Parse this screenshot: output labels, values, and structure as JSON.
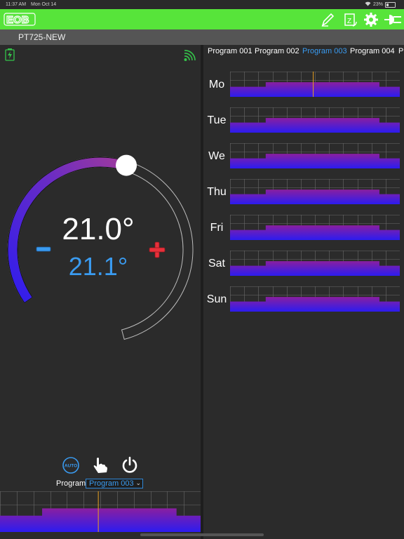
{
  "status_bar": {
    "time": "11:37 AM",
    "date": "Mon Oct 14",
    "battery": "23%"
  },
  "app": {
    "device_name": "PT725-NEW"
  },
  "colors": {
    "accent_green": "#57e43a",
    "accent_blue": "#3a9bf0",
    "minus": "#3a9bf0",
    "plus": "#e8303a",
    "graph_top": "#8a1fa0",
    "graph_bottom": "#2c1cf0",
    "now_line": "#e8a020"
  },
  "toolbar": {
    "icons": [
      "pencil-icon",
      "sync-z-icon",
      "gear-icon",
      "plug-icon"
    ]
  },
  "thermostat": {
    "setpoint": "21.0°",
    "current": "21.1°",
    "setpoint_fraction": 0.49
  },
  "modes": {
    "auto_label": "AUTO",
    "icons": [
      "auto-icon",
      "hand-icon",
      "power-icon"
    ]
  },
  "program_selector": {
    "label": "Program",
    "selected": "Program 003"
  },
  "programs": {
    "tabs": [
      "Program 001",
      "Program 002",
      "Program 003",
      "Program 004",
      "Pr"
    ],
    "active_index": 2
  },
  "days": [
    "Mo",
    "Tue",
    "We",
    "Thu",
    "Fri",
    "Sat",
    "Sun"
  ]
}
